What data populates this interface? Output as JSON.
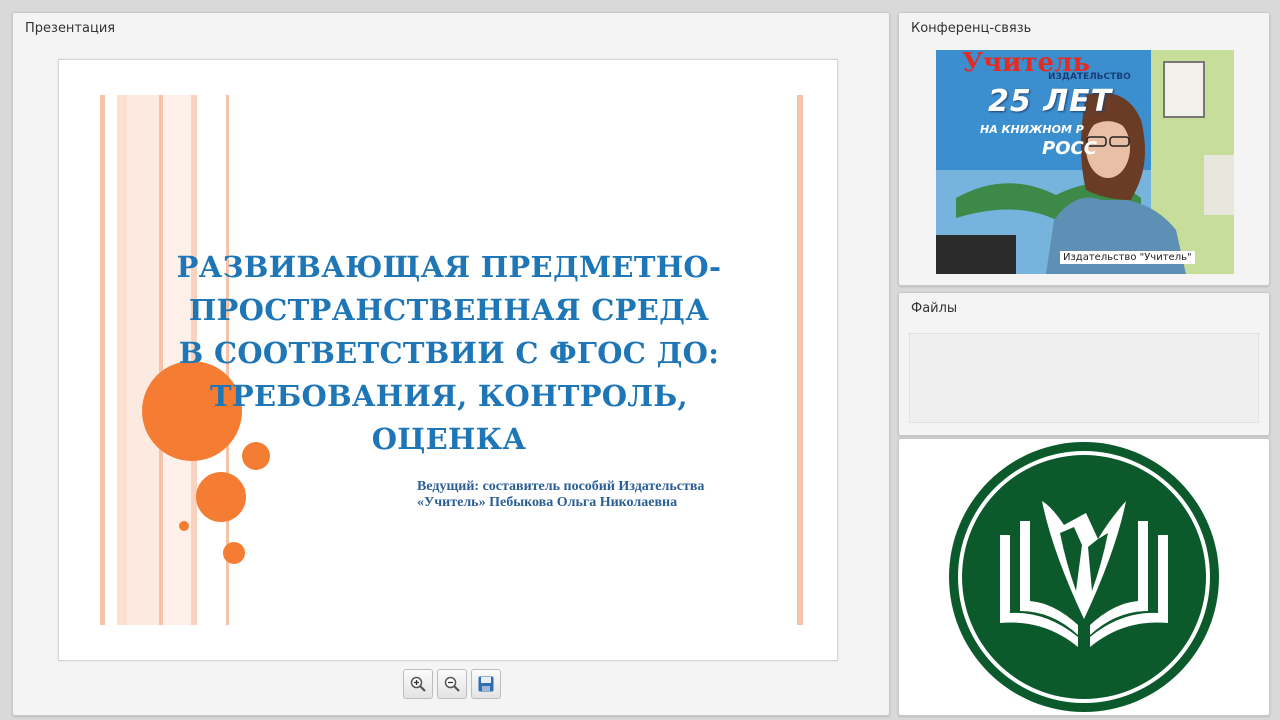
{
  "presentation": {
    "panel_title": "Презентация",
    "slide": {
      "title": "РАЗВИВАЮЩАЯ ПРЕДМЕТНО-\nПРОСТРАНСТВЕННАЯ СРЕДА\nВ СООТВЕТСТВИИ С ФГОС ДО:\nТРЕБОВАНИЯ, КОНТРОЛЬ,\nОЦЕНКА",
      "subtitle": "Ведущий: составитель пособий Издательства\n«Учитель» Пебыкова Ольга Николаевна",
      "colors": {
        "title": "#1f76b6",
        "accent": "#f47c33",
        "stripe": "#f6c2aa"
      }
    },
    "toolbar": [
      {
        "icon": "zoom-in-icon"
      },
      {
        "icon": "zoom-out-icon"
      },
      {
        "icon": "save-icon"
      }
    ]
  },
  "conference": {
    "panel_title": "Конференц-связь",
    "video_label": "Издательство \"Учитель\"",
    "banner": {
      "brand": "Учитель",
      "sub": "ИЗДАТЕЛЬСТВО",
      "big": "25 ЛЕТ",
      "line1": "НА КНИЖНОМ Р",
      "line2": "РОСС"
    }
  },
  "files": {
    "panel_title": "Файлы"
  },
  "logo": {
    "color": "#0c5a2c"
  }
}
